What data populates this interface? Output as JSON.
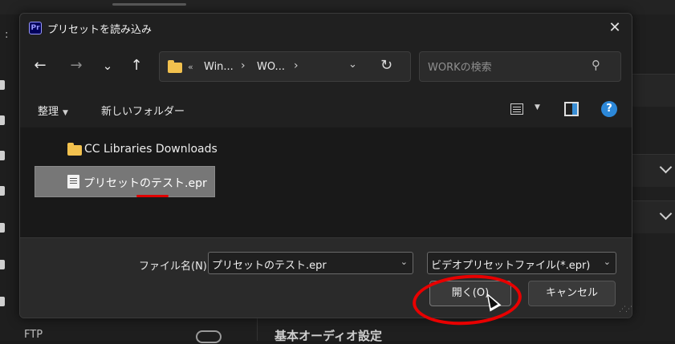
{
  "background": {
    "colon": ":",
    "ftp_label": "FTP",
    "audio_section": "基本オーディオ設定"
  },
  "dialog": {
    "app_icon": "Pr",
    "title": "プリセットを読み込み",
    "close": "✕",
    "nav": {
      "back": "←",
      "forward": "→",
      "recent": "⌄",
      "up": "↑"
    },
    "address": {
      "overflow": "«",
      "crumbs": [
        "Win...",
        "WO..."
      ],
      "separator": "›",
      "dropdown": "⌄",
      "refresh": "↻"
    },
    "search": {
      "placeholder": "WORKの検索",
      "icon": "⚲"
    },
    "toolbar": {
      "organize": "整理",
      "new_folder": "新しいフォルダー",
      "help": "?"
    },
    "files": [
      {
        "name": "CC Libraries Downloads",
        "type": "folder"
      },
      {
        "name": "プリセットのテスト.epr",
        "type": "epr",
        "selected": true
      }
    ],
    "footer": {
      "filename_label": "ファイル名(N):",
      "filename_value": "プリセットのテスト.epr",
      "filetype_value": "ビデオプリセットファイル(*.epr)",
      "open_button": "開く(O)",
      "cancel_button": "キャンセル"
    }
  },
  "colors": {
    "annotation": "#e80000",
    "folder": "#f2c14e",
    "help": "#2c88d9",
    "selection": "#777777"
  }
}
